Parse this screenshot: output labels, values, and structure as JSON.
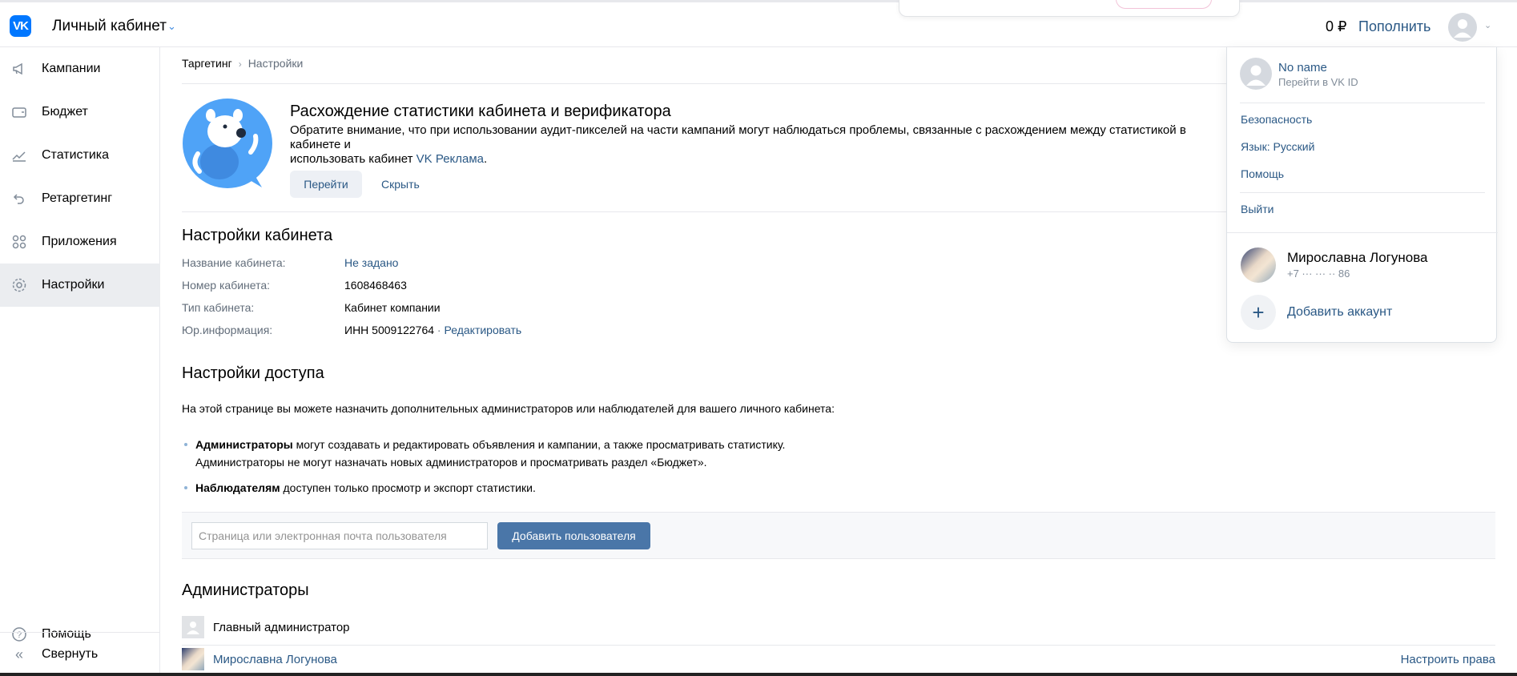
{
  "header": {
    "logo": "VK",
    "cabinet_title": "Личный кабинет",
    "balance": "0 ₽",
    "topup_label": "Пополнить"
  },
  "sidebar": {
    "items": [
      {
        "label": "Кампании",
        "icon": "megaphone-icon"
      },
      {
        "label": "Бюджет",
        "icon": "wallet-icon"
      },
      {
        "label": "Статистика",
        "icon": "chart-icon"
      },
      {
        "label": "Ретаргетинг",
        "icon": "retarget-icon"
      },
      {
        "label": "Приложения",
        "icon": "apps-icon"
      },
      {
        "label": "Настройки",
        "icon": "gear-icon",
        "active": true
      }
    ],
    "help_label": "Помощь",
    "collapse_label": "Свернуть"
  },
  "breadcrumb": {
    "root": "Таргетинг",
    "current": "Настройки"
  },
  "banner": {
    "title": "Расхождение статистики кабинета и верификатора",
    "text": "Обратите внимание, что при использовании аудит-пикселей на части кампаний могут наблюдаться проблемы, связанные с расхождением между статистикой в кабинете и",
    "text_line2": "использовать кабинет ",
    "link_text": "VK Реклама",
    "text_end": ".",
    "go_label": "Перейти",
    "hide_label": "Скрыть"
  },
  "cabinet_settings": {
    "title": "Настройки кабинета",
    "name_label": "Название кабинета:",
    "name_value": "Не задано",
    "number_label": "Номер кабинета:",
    "number_value": "1608468463",
    "type_label": "Тип кабинета:",
    "type_value": "Кабинет компании",
    "legal_label": "Юр.информация:",
    "legal_value": "ИНН 5009122764",
    "legal_sep": " · ",
    "edit_label": "Редактировать"
  },
  "access": {
    "title": "Настройки доступа",
    "intro": "На этой странице вы можете назначить дополнительных администраторов или наблюдателей для вашего личного кабинета:",
    "admins_bold": "Администраторы",
    "admins_text": " могут создавать и редактировать объявления и кампании, а также просматривать статистику.",
    "admins_text2": "Администраторы не могут назначать новых администраторов и просматривать раздел «Бюджет».",
    "observers_bold": "Наблюдателям",
    "observers_text": " доступен только просмотр и экспорт статистики.",
    "input_placeholder": "Страница или электронная почта пользователя",
    "add_button": "Добавить пользователя"
  },
  "admins": {
    "title": "Администраторы",
    "rows": [
      {
        "name": "Главный администратор"
      },
      {
        "name": "Мирославна Логунова",
        "action": "Настроить права"
      }
    ]
  },
  "dropdown": {
    "profile_name": "No name",
    "profile_sub": "Перейти в VK ID",
    "security": "Безопасность",
    "language": "Язык: Русский",
    "help": "Помощь",
    "logout": "Выйти",
    "account_name": "Мирославна Логунова",
    "account_phone": "+7 ··· ··· ·· 86",
    "add_account": "Добавить аккаунт"
  }
}
